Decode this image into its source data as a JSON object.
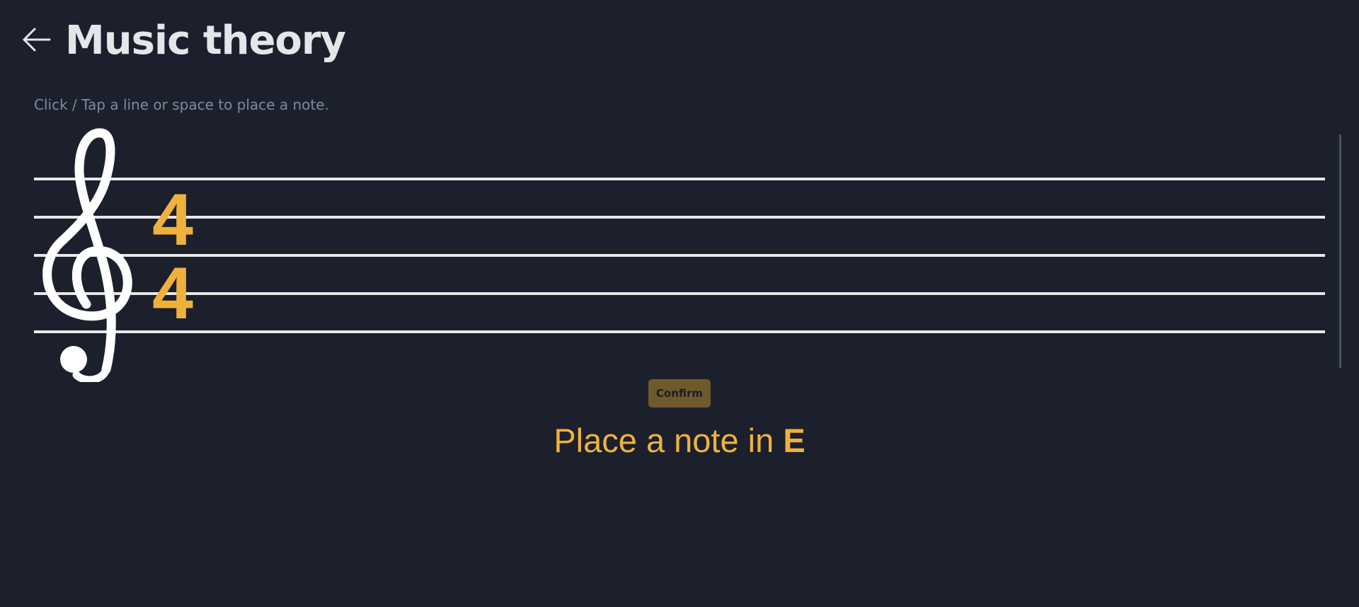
{
  "header": {
    "back_icon": "arrow-left-icon",
    "title": "Music theory"
  },
  "exercise": {
    "instruction": "Click / Tap a line or space to place a note.",
    "clef_icon": "treble-clef-icon",
    "time_signature": {
      "top": "4",
      "bottom": "4"
    },
    "confirm_label": "Confirm",
    "prompt_prefix": "Place a note in",
    "prompt_note": "E"
  },
  "colors": {
    "background": "#1b202c",
    "accent": "#f0b13c",
    "confirm_bg": "#6f5a2e",
    "staff_line": "#e8e8e8",
    "title": "#e4e6ea",
    "instruction": "#7f8a9c"
  }
}
